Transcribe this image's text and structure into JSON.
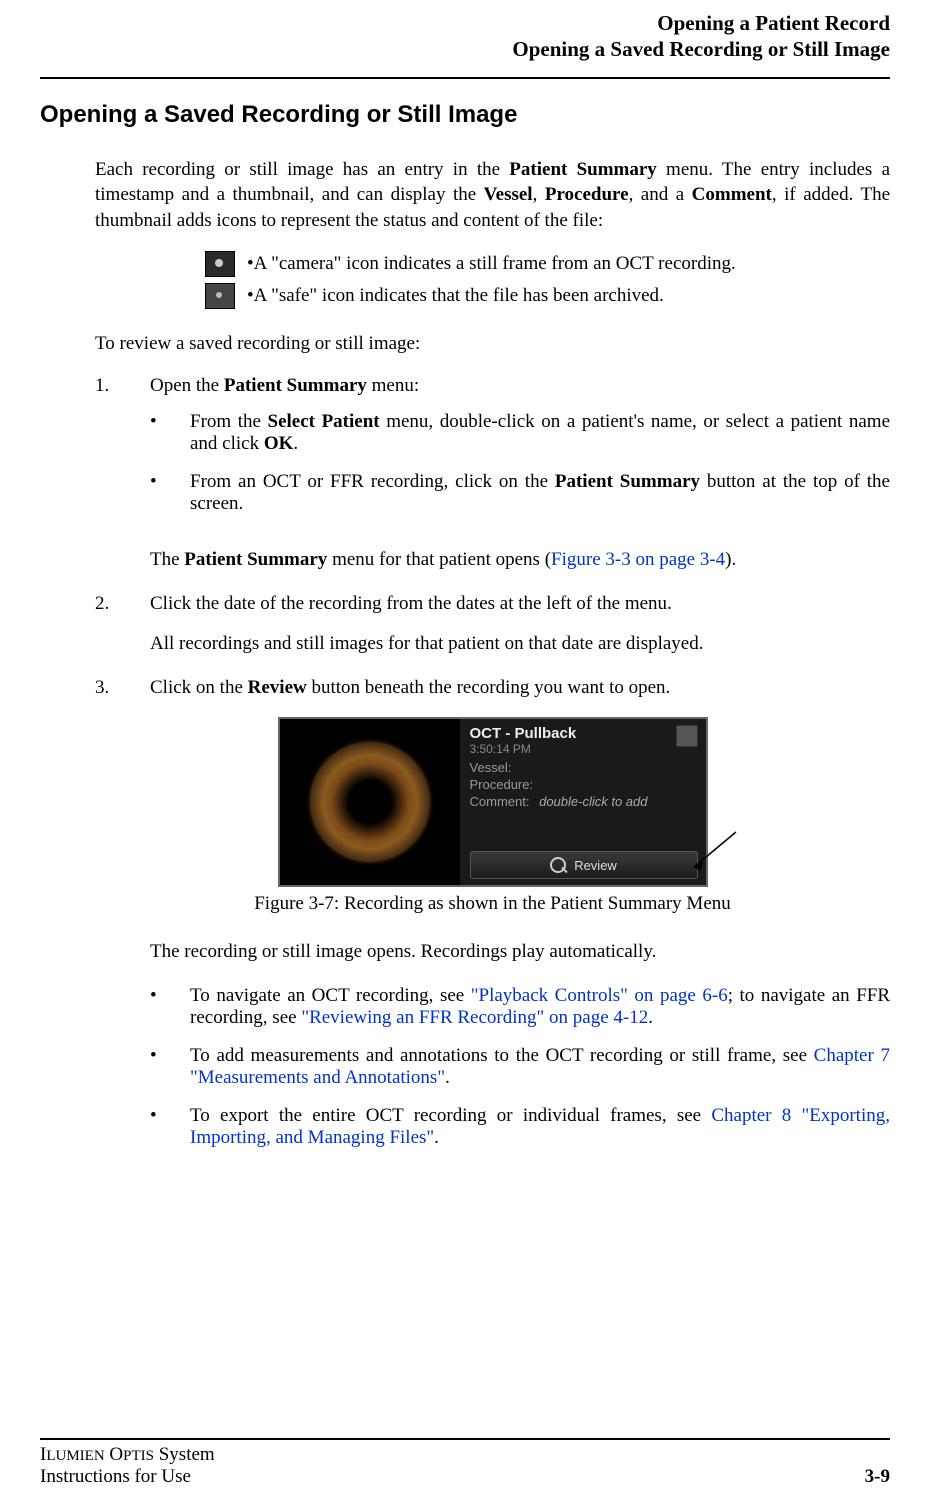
{
  "header": {
    "line1": "Opening a Patient Record",
    "line2": "Opening a Saved Recording or Still Image"
  },
  "section_title": "Opening a Saved Recording or Still Image",
  "intro": {
    "pre": "Each recording or still image has an entry in the ",
    "b1": "Patient Summary",
    "mid1": " menu. The entry includes a timestamp and a thumbnail, and can display the ",
    "b2": "Vessel",
    "sep1": ", ",
    "b3": "Procedure",
    "sep2": ", and a ",
    "b4": "Comment",
    "post": ", if added.  The thumbnail adds icons to represent the status and content of the file:"
  },
  "icons": {
    "camera": "•A \"camera\" icon indicates a still frame from an OCT recording.",
    "safe": "•A \"safe\" icon indicates that the file has been archived."
  },
  "review_intro": "To review a saved recording or still image:",
  "step1": {
    "num": "1.",
    "pre": "Open the ",
    "b": "Patient Summary",
    "post": " menu:",
    "bullet_a": {
      "pre": "From the ",
      "b1": "Select Patient",
      "mid": " menu, double-click on a patient's name, or select a patient name and click ",
      "b2": "OK",
      "post": "."
    },
    "bullet_b": {
      "pre": "From an OCT or FFR recording, click on the ",
      "b": "Patient Summary",
      "post": " button at the top of the screen."
    },
    "after": {
      "pre": "The ",
      "b": "Patient Summary",
      "mid": " menu for that patient opens (",
      "link": "Figure 3-3 on page 3-4",
      "post": ")."
    }
  },
  "step2": {
    "num": "2.",
    "text": "Click the date of the recording from the dates at the left of the menu.",
    "after": "All recordings and still images for that patient on that date are displayed."
  },
  "step3": {
    "num": "3.",
    "pre": "Click on the ",
    "b": "Review",
    "post": " button beneath the recording you want to open."
  },
  "figure": {
    "title": "OCT - Pullback",
    "time": "3:50:14 PM",
    "vessel_label": "Vessel:",
    "procedure_label": "Procedure:",
    "comment_label": "Comment:",
    "comment_hint": "double-click to add",
    "review_btn": "Review",
    "caption": "Figure 3-7:  Recording as shown in the Patient Summary Menu"
  },
  "after_figure": "The recording or still image opens. Recordings play automatically.",
  "final_bullets": {
    "a": {
      "pre": "To navigate an OCT recording, see ",
      "link1": "\"Playback Controls\" on page 6-6",
      "mid": "; to navigate an FFR recording, see ",
      "link2": "\"Reviewing an FFR Recording\" on page 4-12",
      "post": "."
    },
    "b": {
      "pre": "To add measurements and annotations to the OCT recording or still frame, see ",
      "link": "Chapter 7 \"Measurements and Annotations\"",
      "post": "."
    },
    "c": {
      "pre": "To export the entire OCT recording or individual frames, see ",
      "link": "Chapter 8 \"Exporting, Importing, and Managing Files\"",
      "post": "."
    }
  },
  "footer": {
    "line1_pre": "I",
    "line1_sc1": "LUMIEN",
    "line1_mid": " O",
    "line1_sc2": "PTIS",
    "line1_post": " System",
    "line2": "Instructions for Use",
    "page": "3-9"
  },
  "bullet_char": "•"
}
